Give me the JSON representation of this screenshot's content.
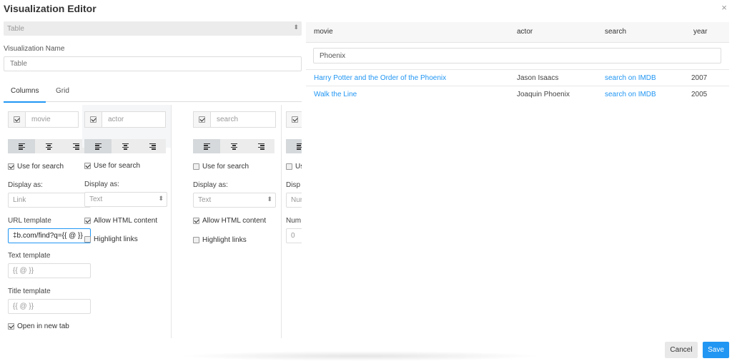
{
  "modal": {
    "title": "Visualization Editor",
    "close_label": "×"
  },
  "editor": {
    "type_value": "Table",
    "name_label": "Visualization Name",
    "name_placeholder": "Table",
    "tabs": [
      {
        "label": "Columns",
        "active": true
      },
      {
        "label": "Grid",
        "active": false
      }
    ]
  },
  "columns": [
    {
      "name": "movie",
      "visible": true,
      "align": "left",
      "use_for_search": {
        "label": "Use for search",
        "checked": true
      },
      "display_as_label": "Display as:",
      "display_as_value": "Link",
      "url_template_label": "URL template",
      "url_template_value": "‡b.com/find?q={{ @ }}",
      "text_template_label": "Text template",
      "text_template_placeholder": "{{ @ }}",
      "title_template_label": "Title template",
      "title_template_placeholder": "{{ @ }}",
      "open_new_tab": {
        "label": "Open in new tab",
        "checked": true
      }
    },
    {
      "name": "actor",
      "visible": true,
      "align": "left",
      "use_for_search": {
        "label": "Use for search",
        "checked": true
      },
      "display_as_label": "Display as:",
      "display_as_value": "Text",
      "allow_html": {
        "label": "Allow HTML content",
        "checked": true
      },
      "highlight_links": {
        "label": "Highlight links",
        "checked": false
      }
    },
    {
      "name": "search",
      "visible": true,
      "align": "left",
      "use_for_search": {
        "label": "Use for search",
        "checked": false
      },
      "display_as_label": "Display as:",
      "display_as_value": "Text",
      "allow_html": {
        "label": "Allow HTML content",
        "checked": true
      },
      "highlight_links": {
        "label": "Highlight links",
        "checked": false
      }
    },
    {
      "name": "",
      "visible": true,
      "use_for_search_partial": "Us",
      "display_as_partial": "Disp",
      "display_as_value_partial": "Nur",
      "number_label_partial": "Num",
      "number_value_partial": "0"
    }
  ],
  "preview": {
    "headers": [
      "movie",
      "actor",
      "search",
      "year"
    ],
    "search_value": "Phoenix",
    "rows": [
      {
        "movie": "Harry Potter and the Order of the Phoenix",
        "actor": "Jason Isaacs",
        "search": "search on IMDB",
        "year": "2007"
      },
      {
        "movie": "Walk the Line",
        "actor": "Joaquin Phoenix",
        "search": "search on IMDB",
        "year": "2005"
      }
    ]
  },
  "footer": {
    "cancel_label": "Cancel",
    "save_label": "Save"
  },
  "colors": {
    "accent": "#2196f3",
    "selected_align": "#d5d9dc"
  }
}
